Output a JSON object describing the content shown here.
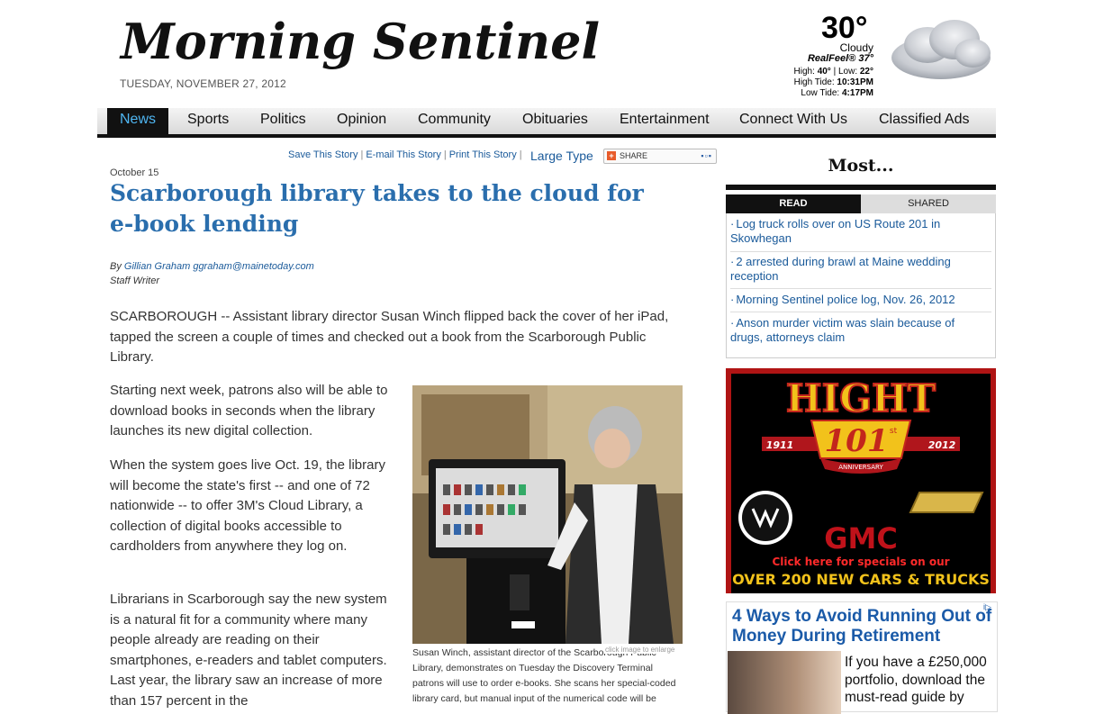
{
  "masthead": {
    "title": "Morning Sentinel",
    "date": "TUESDAY, NOVEMBER 27, 2012"
  },
  "weather": {
    "temperature": "30°",
    "condition": "Cloudy",
    "realfeel_label": "RealFeel®",
    "realfeel_value": "37°",
    "high_label": "High:",
    "high": "40°",
    "low_label": "Low:",
    "low": "22°",
    "high_tide_label": "High Tide:",
    "high_tide": "10:31PM",
    "low_tide_label": "Low Tide:",
    "low_tide": "4:17PM",
    "icon": "cloud-icon"
  },
  "nav": {
    "items": [
      {
        "label": "News",
        "active": true
      },
      {
        "label": "Sports"
      },
      {
        "label": "Politics"
      },
      {
        "label": "Opinion"
      },
      {
        "label": "Community"
      },
      {
        "label": "Obituaries"
      },
      {
        "label": "Entertainment"
      },
      {
        "label": "Connect With Us"
      },
      {
        "label": "Classified Ads"
      }
    ]
  },
  "tools": {
    "save": "Save This Story",
    "email": "E-mail This Story",
    "print": "Print This Story",
    "large_type": "Large Type",
    "share": "SHARE"
  },
  "article": {
    "date": "October 15",
    "headline": "Scarborough library takes to the cloud for e-book lending",
    "by": "By",
    "author": "Gillian Graham ggraham@mainetoday.com",
    "author_title": "Staff Writer",
    "paragraphs": [
      "SCARBOROUGH -- Assistant library director Susan Winch flipped back the cover of her iPad, tapped the screen a couple of times and checked out a book from the Scarborough Public Library.",
      "Starting next week, patrons also will be able to download books in seconds when the library launches its new digital collection.",
      "When the system goes live Oct. 19, the library will become the state's first -- and one of 72 nationwide -- to offer 3M's Cloud Library, a collection of digital books accessible to cardholders from anywhere they log on.",
      "Librarians in Scarborough say the new system is a natural fit for a community where many people already are reading on their smartphones, e-readers and tablet computers. Last year, the library saw an increase of more than 157 percent in the"
    ],
    "photo_caption": "Susan Winch, assistant director of the Scarborough Public Library, demonstrates on Tuesday the Discovery Terminal patrons will use to order e-books. She scans her special-coded library card, but manual input of the numerical code will be",
    "photo_hint": "click image to enlarge"
  },
  "most": {
    "title": "Most...",
    "tab_read": "READ",
    "tab_shared": "SHARED",
    "items": [
      "Log truck rolls over on US Route 201 in Skowhegan",
      "2 arrested during brawl at Maine wedding reception",
      "Morning Sentinel police log, Nov. 26, 2012",
      "Anson murder victim was slain because of drugs, attorneys claim"
    ]
  },
  "ad": {
    "brand": "HIGHT",
    "years_left": "1911",
    "years_right": "2012",
    "number": "101",
    "suffix": "st",
    "anniversary": "ANNIVERSARY",
    "gmc": "GMC",
    "cta": "Click here for specials on our",
    "offer": "OVER 200 NEW CARS & TRUCKS"
  },
  "ad2": {
    "title": "4 Ways to Avoid Running Out of Money During Retirement",
    "text": "If you have a £250,000 portfolio, download the must-read guide by",
    "badge": "i▷"
  }
}
